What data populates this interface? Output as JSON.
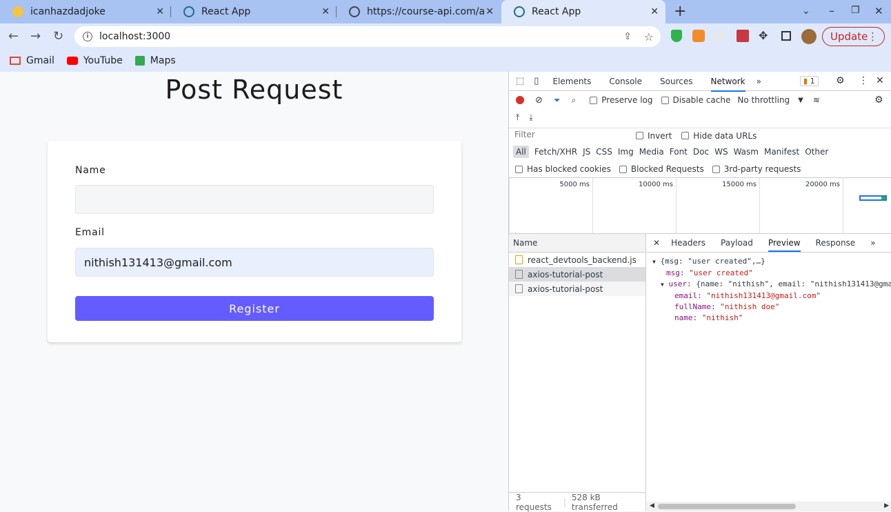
{
  "tabs": [
    {
      "title": "icanhazdadjoke"
    },
    {
      "title": "React App"
    },
    {
      "title": "https://course-api.com/a"
    },
    {
      "title": "React App"
    }
  ],
  "toolbar": {
    "url": "localhost:3000",
    "update_label": "Update"
  },
  "bookmarks": [
    {
      "label": "Gmail"
    },
    {
      "label": "YouTube"
    },
    {
      "label": "Maps"
    }
  ],
  "page": {
    "title": "Post Request",
    "name_label": "Name",
    "name_value": "",
    "email_label": "Email",
    "email_value": "nithish131413@gmail.com",
    "register_label": "Register"
  },
  "devtools": {
    "tabs": [
      "Elements",
      "Console",
      "Sources",
      "Network"
    ],
    "more": "»",
    "issues_count": "1",
    "preserve_log": "Preserve log",
    "disable_cache": "Disable cache",
    "throttling": "No throttling",
    "filter_placeholder": "Filter",
    "invert": "Invert",
    "hide_data_urls": "Hide data URLs",
    "filter_types": [
      "All",
      "Fetch/XHR",
      "JS",
      "CSS",
      "Img",
      "Media",
      "Font",
      "Doc",
      "WS",
      "Wasm",
      "Manifest",
      "Other"
    ],
    "has_blocked_cookies": "Has blocked cookies",
    "blocked_requests": "Blocked Requests",
    "third_party": "3rd-party requests",
    "timeline_ticks": [
      "5000 ms",
      "10000 ms",
      "15000 ms",
      "20000 ms"
    ],
    "name_header": "Name",
    "requests": [
      "react_devtools_backend.js",
      "axios-tutorial-post",
      "axios-tutorial-post"
    ],
    "status_requests": "3 requests",
    "status_transferred": "528 kB transferred",
    "detail_tabs": [
      "Headers",
      "Payload",
      "Preview",
      "Response"
    ],
    "preview": {
      "root": "{msg: \"user created\",…}",
      "msg_key": "msg:",
      "msg_val": "\"user created\"",
      "user_key": "user:",
      "user_summary": "{name: \"nithish\", email: \"nithish131413@gma",
      "email_key": "email:",
      "email_val": "\"nithish131413@gmail.com\"",
      "fullName_key": "fullName:",
      "fullName_val": "\"nithish doe\"",
      "name_key": "name:",
      "name_val": "\"nithish\""
    }
  },
  "colors": {
    "accent": "#645cff",
    "chrome_tabbar": "#a8c2f2",
    "chrome_toolbar": "#dfe9fb",
    "update": "#c5221f"
  }
}
